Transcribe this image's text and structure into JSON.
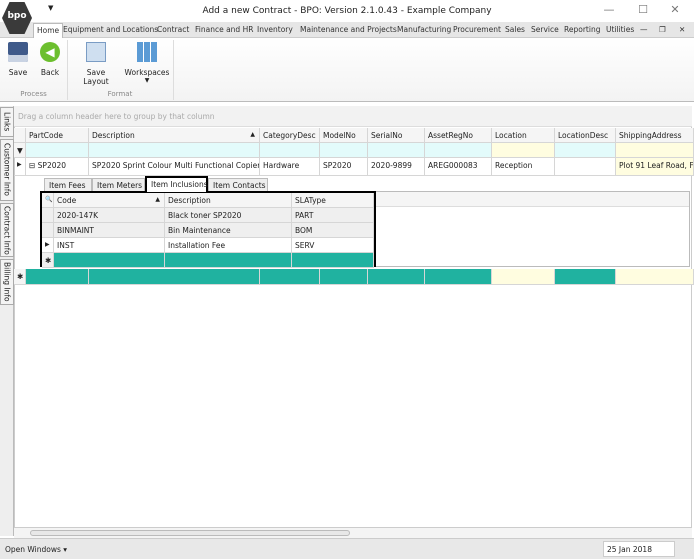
{
  "window": {
    "title": "Add a new Contract - BPO: Version 2.1.0.43 - Example Company",
    "logo": "bpo",
    "minimize": "—",
    "maximize": "☐",
    "close": "✕"
  },
  "ribbon_tabs": [
    "Home",
    "Equipment and Locations",
    "Contract",
    "Finance and HR",
    "Inventory",
    "Maintenance and Projects",
    "Manufacturing",
    "Procurement",
    "Sales",
    "Service",
    "Reporting",
    "Utilities"
  ],
  "mdi": {
    "minimize": "—",
    "restore": "❐",
    "close": "✕"
  },
  "ribbon": {
    "save": "Save",
    "back": "Back",
    "save_layout": "Save Layout",
    "workspaces": "Workspaces",
    "group_process": "Process",
    "group_format": "Format"
  },
  "side_tabs": [
    "Links",
    "Customer Info",
    "Contract Info",
    "Billing Info"
  ],
  "grid": {
    "group_hint": "Drag a column header here to group by that column",
    "columns": [
      "PartCode",
      "Description",
      "CategoryDesc",
      "ModelNo",
      "SerialNo",
      "AssetRegNo",
      "Location",
      "LocationDesc",
      "ShippingAddress"
    ],
    "row": [
      "SP2020",
      "SP2020 Sprint Colour Multi Functional Copier",
      "Hardware",
      "SP2020",
      "2020-9899",
      "AREG000083",
      "Reception",
      "",
      "Plot 91 Leaf Road, Fo"
    ]
  },
  "detail": {
    "tabs": [
      "Item Fees",
      "Item Meters",
      "Item Inclusions",
      "Item Contacts"
    ],
    "active_tab": "Item Inclusions",
    "columns": [
      "Code",
      "Description",
      "SLAType"
    ],
    "rows": [
      [
        "2020-147K",
        "Black toner SP2020",
        "PART"
      ],
      [
        "BINMAINT",
        "Bin Maintenance",
        "BOM"
      ],
      [
        "INST",
        "Installation Fee",
        "SERV"
      ]
    ]
  },
  "status": {
    "open_windows": "Open Windows ▾",
    "date": "25 Jan 2018"
  },
  "colors": {
    "new_row": "#20b2a0",
    "filter_row": "#e3fbfb",
    "highlight": "#fffde0"
  }
}
